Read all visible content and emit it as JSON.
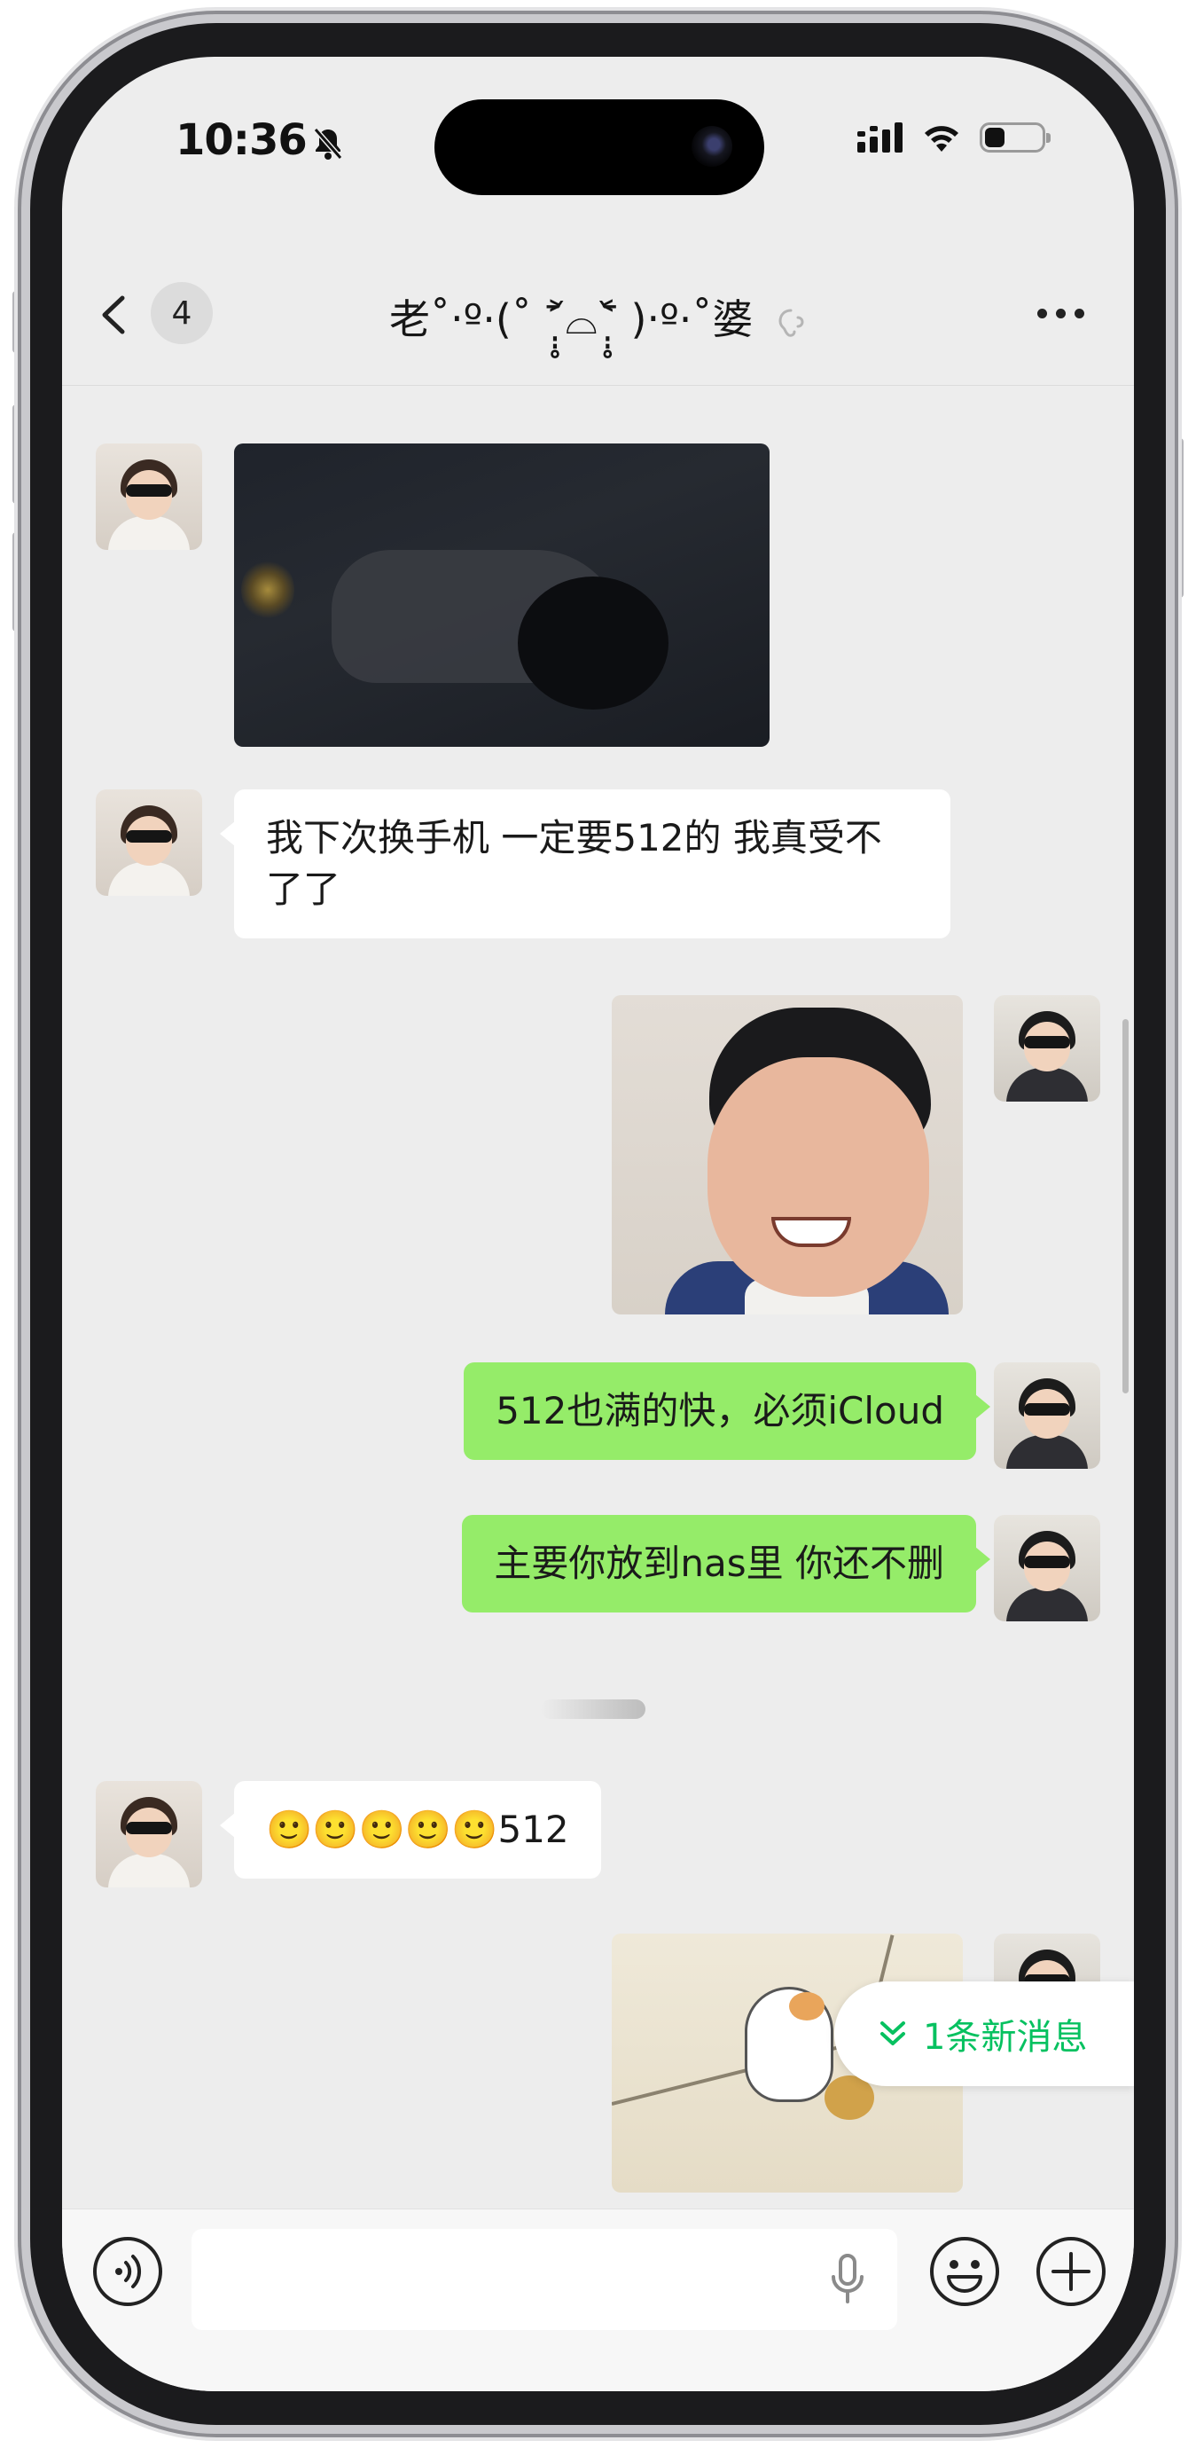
{
  "status_bar": {
    "time": "10:36",
    "battery_percent": 35
  },
  "navbar": {
    "unread_count": "4",
    "title": "老˚‧º·(˚ ˃̣̣̥᷄⌓˂̣̣̥᷅ )‧º·˚婆"
  },
  "messages": [
    {
      "sender": "other",
      "type": "image",
      "content": "dark photo"
    },
    {
      "sender": "other",
      "type": "text",
      "text": "我下次换手机 一定要512的 我真受不了了"
    },
    {
      "sender": "me",
      "type": "image",
      "content": "smiling child"
    },
    {
      "sender": "me",
      "type": "text",
      "text": "512也满的快，必须iCloud"
    },
    {
      "sender": "me",
      "type": "text",
      "text": "主要你放到nas里 你还不删"
    },
    {
      "sender": "other",
      "type": "text",
      "text": "🙂🙂🙂🙂🙂512"
    },
    {
      "sender": "me",
      "type": "image",
      "content": "hamster sticker"
    }
  ],
  "new_message_tip": "1条新消息",
  "icons": {
    "back": "chevron-left-icon",
    "mute": "bell-slash-icon",
    "voice_note": "ear-icon",
    "more": "more-icon",
    "voice": "voice-icon",
    "mic": "mic-icon",
    "emoji": "emoji-icon",
    "plus": "plus-icon"
  },
  "colors": {
    "accent": "#07c160",
    "bubble_mine": "#95ec69",
    "bubble_other": "#ffffff",
    "chat_bg": "#ededed"
  }
}
